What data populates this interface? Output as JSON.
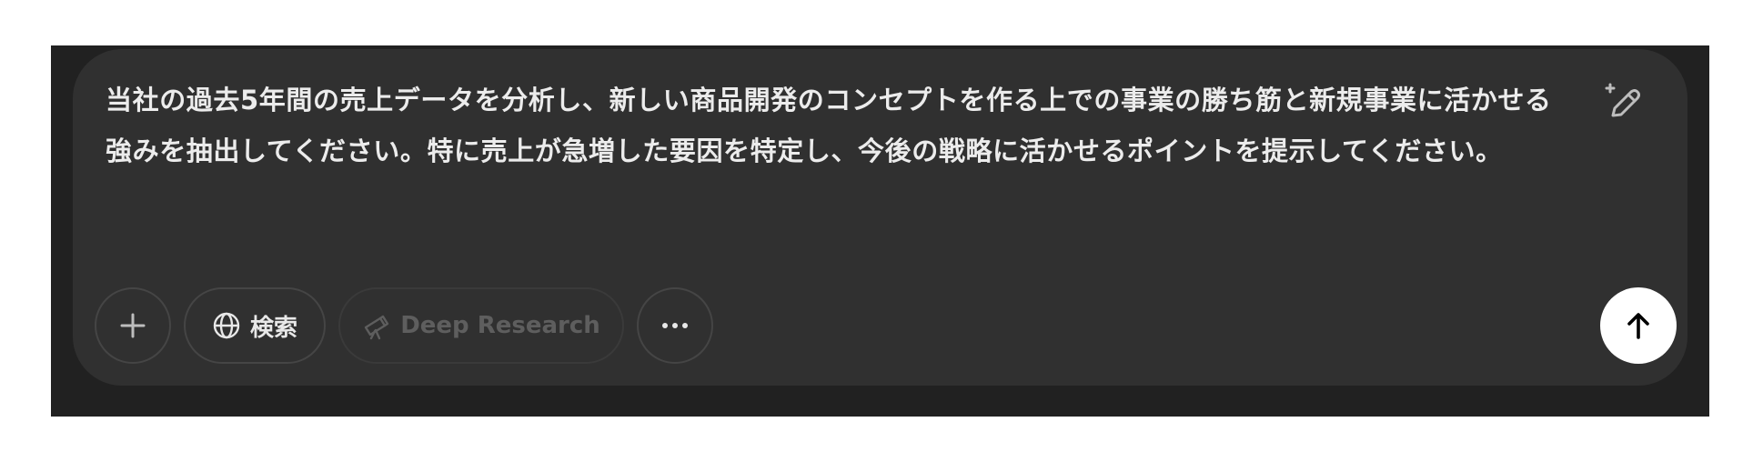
{
  "composer": {
    "prompt": "当社の過去5年間の売上データを分析し、新しい商品開発のコンセプトを作る上での事業の勝ち筋と新規事業に活かせる強みを抽出してください。特に売上が急増した要因を特定し、今後の戦略に活かせるポイントを提示してください。"
  },
  "toolbar": {
    "add_icon": "plus-icon",
    "search_label": "検索",
    "search_icon": "globe-icon",
    "deep_research_label": "Deep Research",
    "deep_research_icon": "telescope-icon",
    "more_icon": "ellipsis-icon",
    "send_icon": "arrow-up-icon",
    "edit_icon": "magic-pencil-icon"
  },
  "colors": {
    "frame_bg": "#212121",
    "composer_bg": "#303030",
    "text": "#ececec",
    "disabled_text": "#5e5e5e",
    "send_bg": "#ffffff"
  }
}
